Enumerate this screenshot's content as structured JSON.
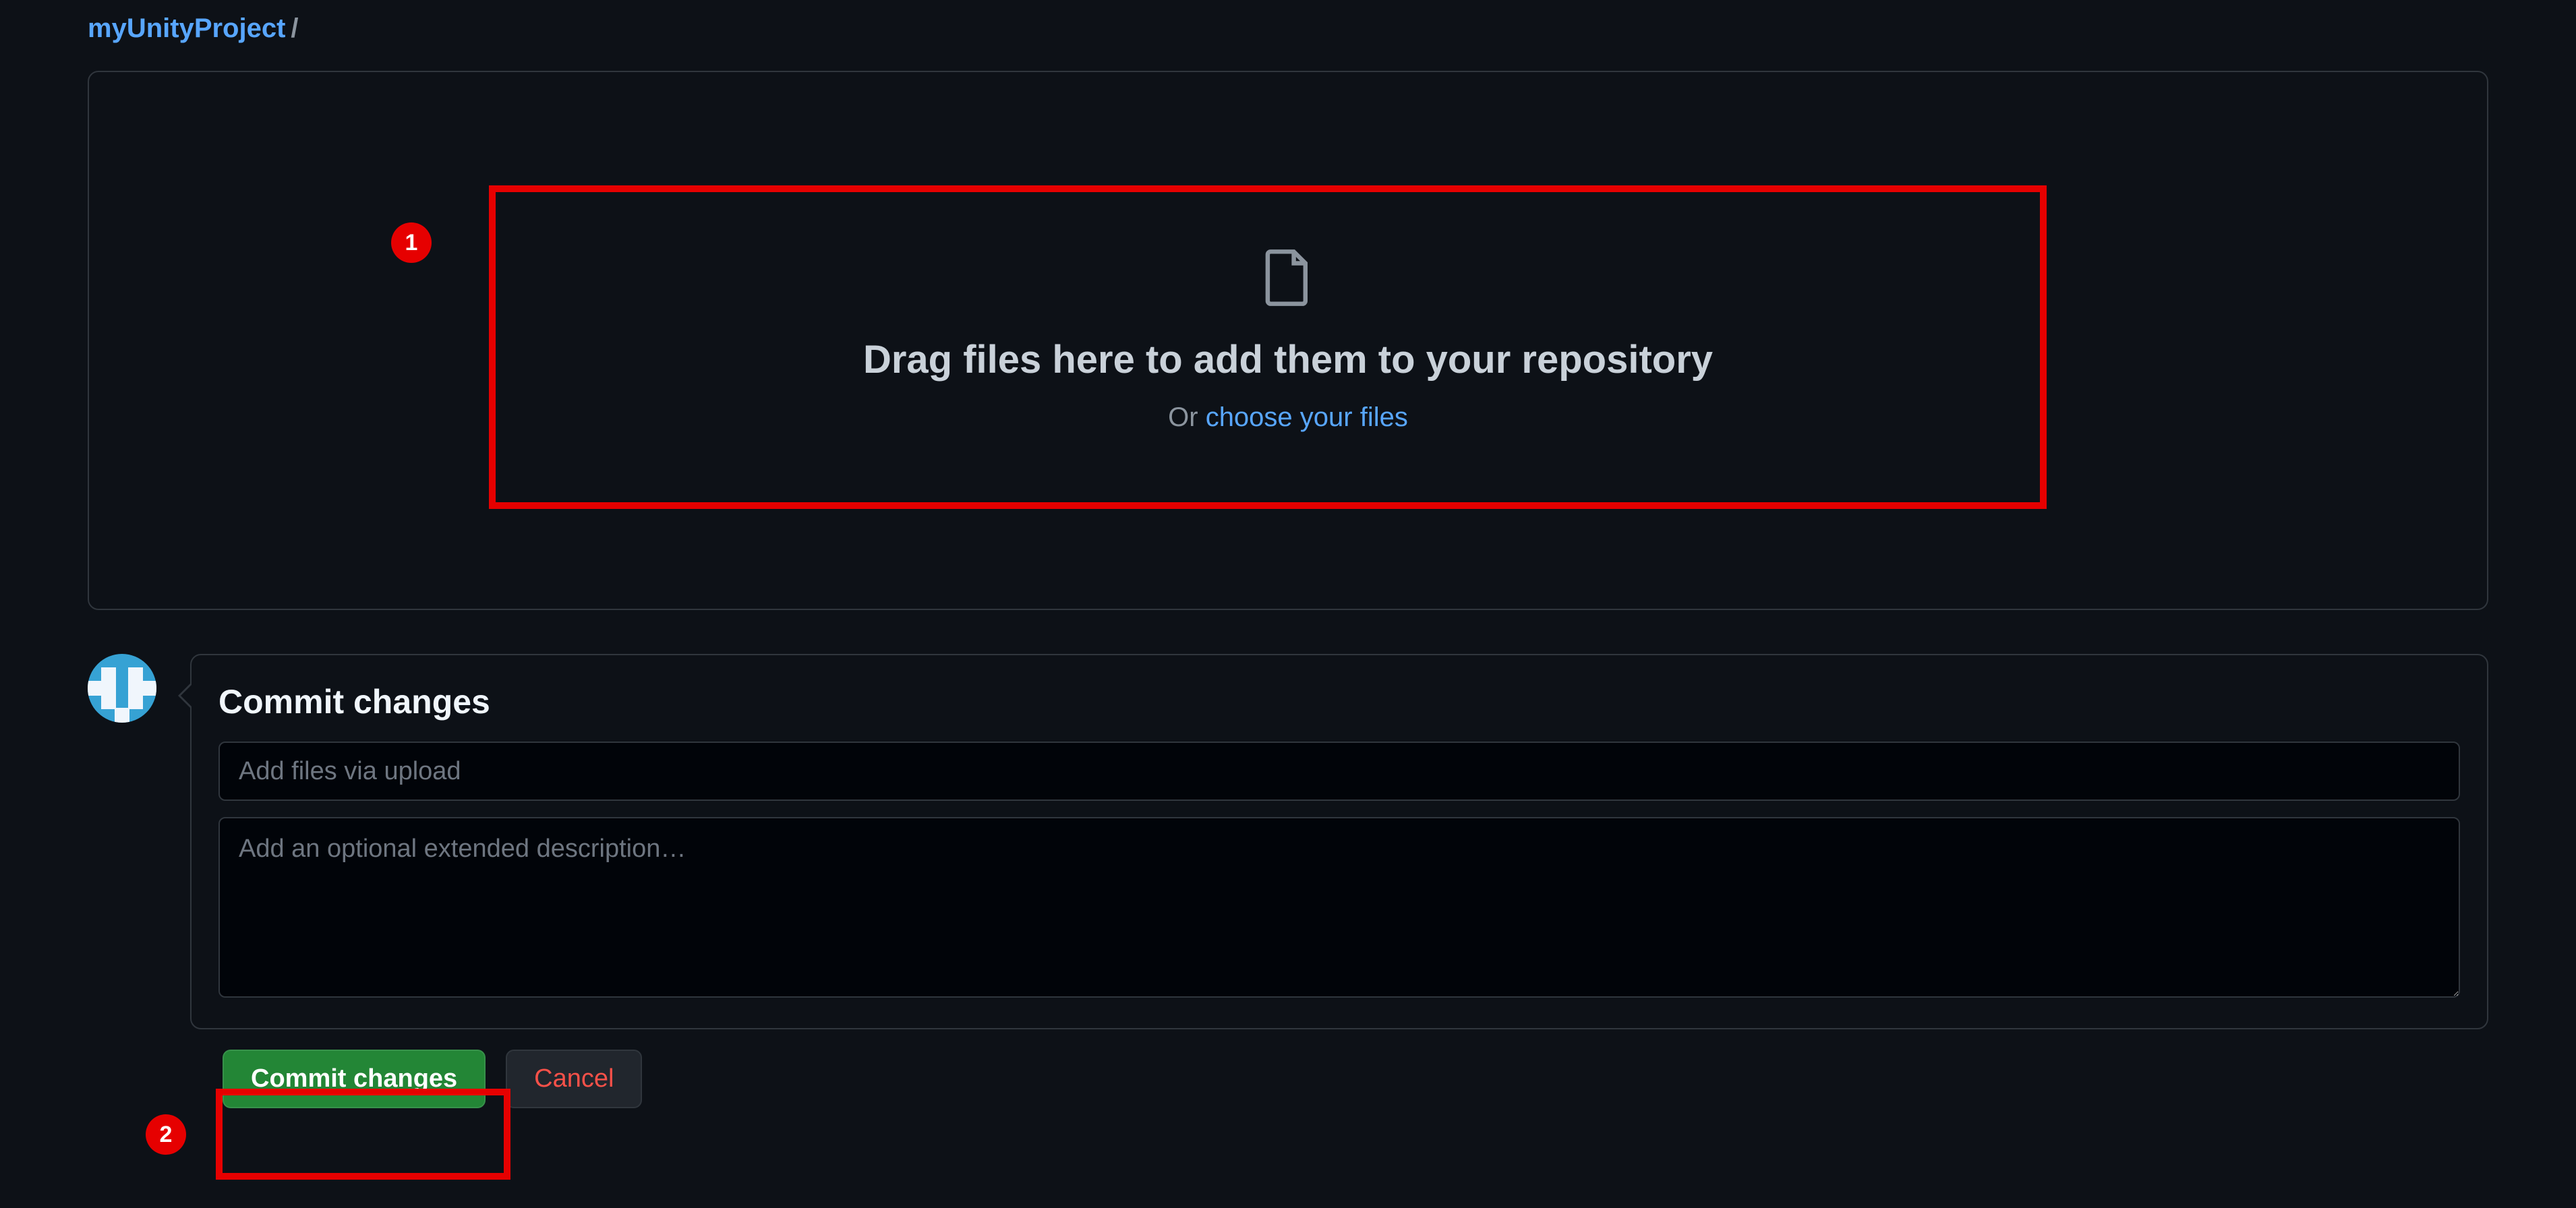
{
  "breadcrumb": {
    "repo": "myUnityProject",
    "sep": "/"
  },
  "upload": {
    "drag_text": "Drag files here to add them to your repository",
    "or_text": "Or ",
    "choose_link": "choose your files"
  },
  "commit": {
    "heading": "Commit changes",
    "summary_placeholder": "Add files via upload",
    "description_placeholder": "Add an optional extended description…",
    "commit_button": "Commit changes",
    "cancel_button": "Cancel"
  },
  "annotations": {
    "badge1": "1",
    "badge2": "2"
  }
}
